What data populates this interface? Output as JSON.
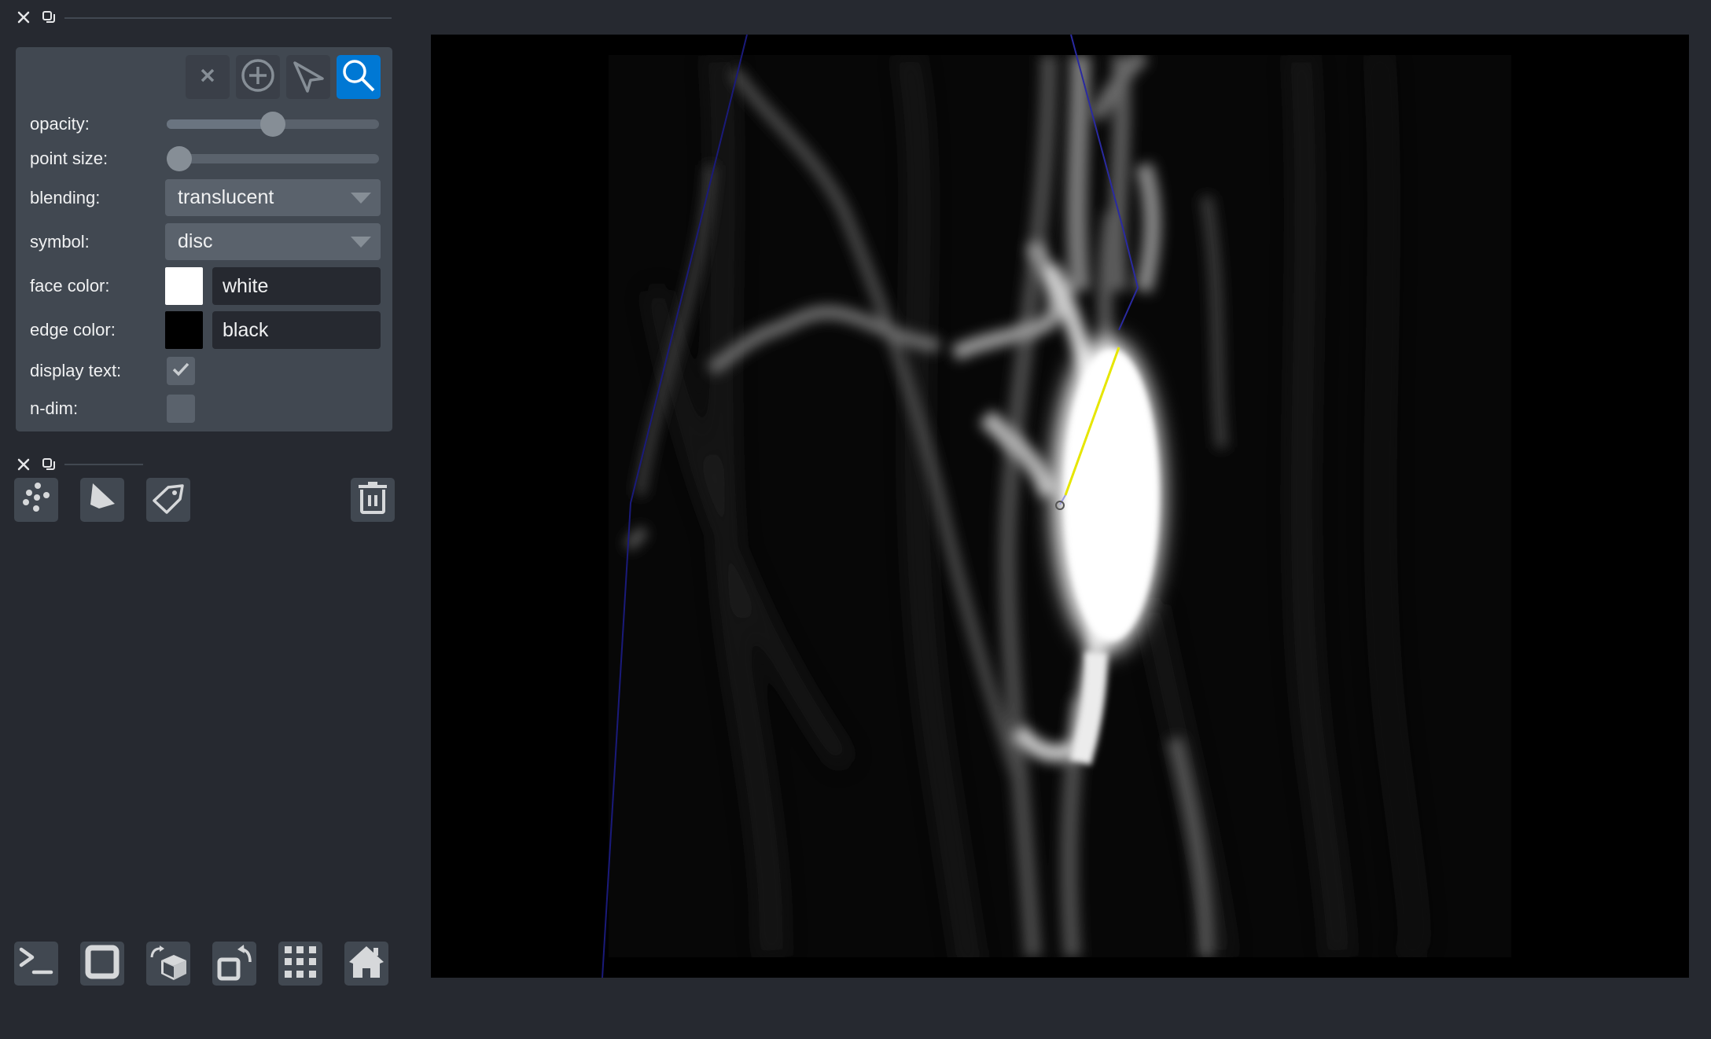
{
  "layer_controls_dock": {
    "close_icon": "close-icon",
    "float_icon": "float-icon"
  },
  "layer_controls": {
    "mode_buttons": [
      {
        "name": "delete-selected-points",
        "icon": "close-icon",
        "active": false
      },
      {
        "name": "add-points",
        "icon": "add-circle-icon",
        "active": false
      },
      {
        "name": "select-points",
        "icon": "pointer-arrow-icon",
        "active": false
      },
      {
        "name": "pan-zoom",
        "icon": "magnifier-icon",
        "active": true
      }
    ],
    "opacity": {
      "label": "opacity:",
      "value": 0.5
    },
    "point_size": {
      "label": "point size:",
      "value": 0.0
    },
    "blending": {
      "label": "blending:",
      "value": "translucent"
    },
    "symbol": {
      "label": "symbol:",
      "value": "disc"
    },
    "face_color": {
      "label": "face color:",
      "value": "white",
      "swatch": "#ffffff"
    },
    "edge_color": {
      "label": "edge color:",
      "value": "black",
      "swatch": "#000000"
    },
    "display_text": {
      "label": "display text:",
      "checked": true
    },
    "n_dim": {
      "label": "n-dim:",
      "checked": false
    }
  },
  "layer_list_dock": {
    "close_icon": "close-icon",
    "float_icon": "float-icon",
    "buttons": [
      {
        "name": "new-points-layer",
        "icon": "points-icon"
      },
      {
        "name": "new-shapes-layer",
        "icon": "polygon-icon"
      },
      {
        "name": "new-labels-layer",
        "icon": "label-tag-icon"
      }
    ],
    "delete_button": {
      "name": "delete-layer",
      "icon": "trash-icon"
    }
  },
  "viewer_buttons": [
    {
      "name": "console",
      "icon": "terminal-icon"
    },
    {
      "name": "toggle-ndisplay",
      "icon": "square-icon"
    },
    {
      "name": "roll-dims",
      "icon": "rotate-cube-icon"
    },
    {
      "name": "transpose-dims",
      "icon": "transpose-icon"
    },
    {
      "name": "grid-view",
      "icon": "grid-icon"
    },
    {
      "name": "reset-view",
      "icon": "home-icon"
    }
  ],
  "canvas": {
    "background": "#000000",
    "image_colormap": "gray",
    "path_colors": {
      "highlight": "#e6e600",
      "path": "#1a1a7a"
    }
  },
  "colors": {
    "background": "#262930",
    "panel": "#414851",
    "accent": "#0078d4",
    "control": "#5a626c",
    "text": "#f0f1f2"
  }
}
